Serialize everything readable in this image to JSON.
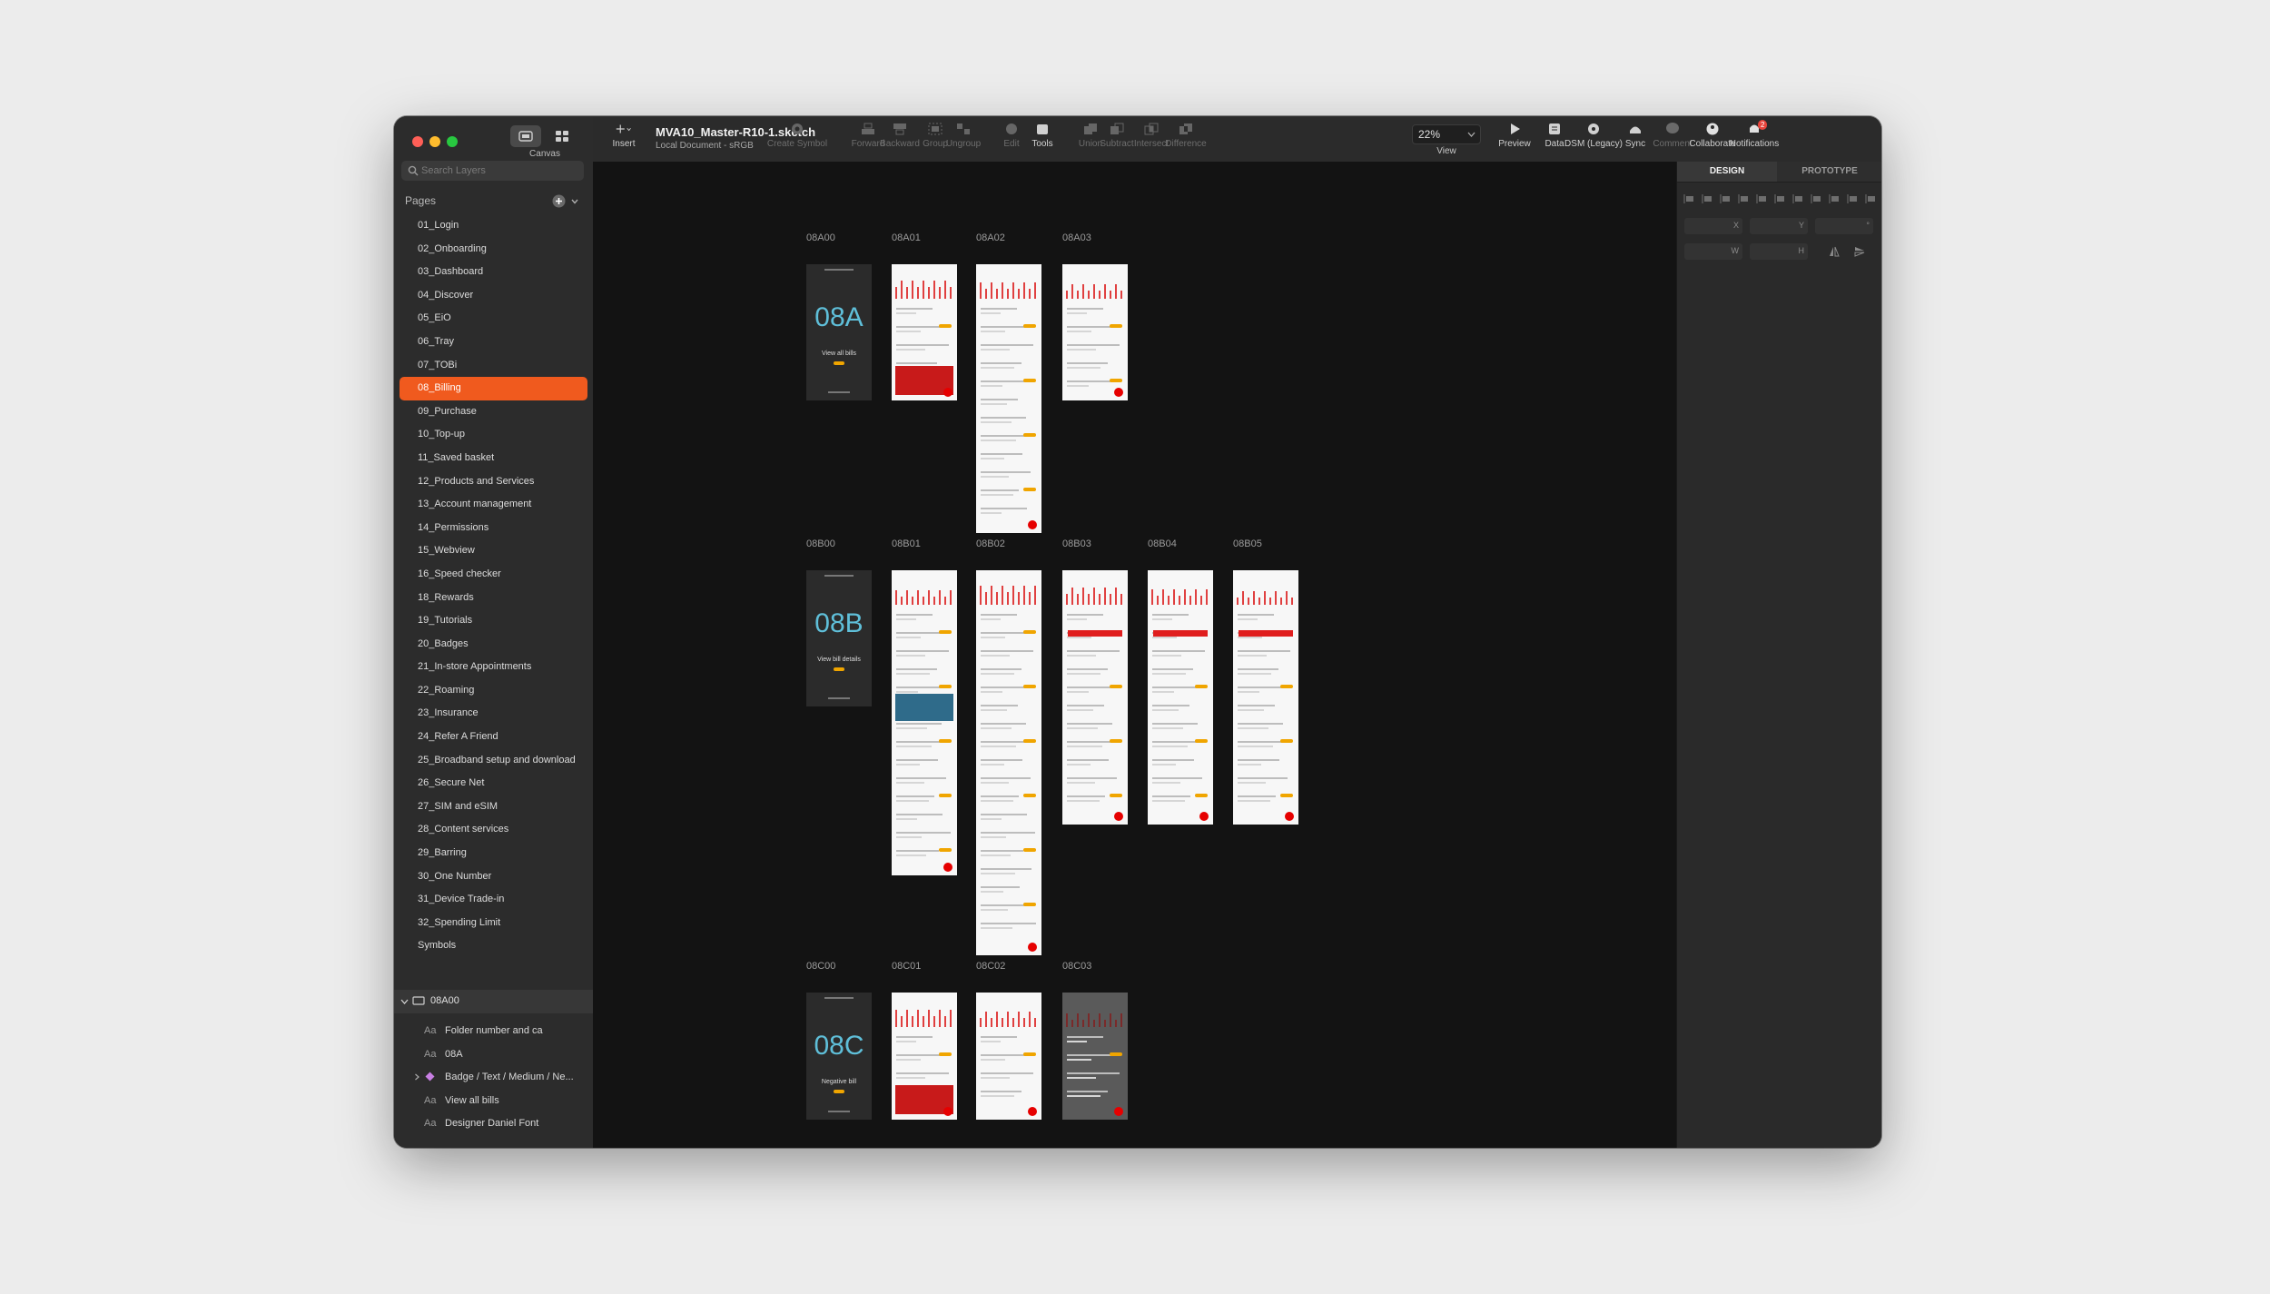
{
  "document": {
    "title": "MVA10_Master-R10-1.sketch",
    "subtitle": "Local Document - sRGB"
  },
  "sidebar": {
    "toggle_label": "Canvas",
    "search_placeholder": "Search Layers",
    "pages_heading": "Pages",
    "pages": [
      "01_Login",
      "02_Onboarding",
      "03_Dashboard",
      "04_Discover",
      "05_EiO",
      "06_Tray",
      "07_TOBi",
      "08_Billing",
      "09_Purchase",
      "10_Top-up",
      "11_Saved basket",
      "12_Products and Services",
      "13_Account management",
      "14_Permissions",
      "15_Webview",
      "16_Speed checker",
      "18_Rewards",
      "19_Tutorials",
      "20_Badges",
      "21_In-store Appointments",
      "22_Roaming",
      "23_Insurance",
      "24_Refer A Friend",
      "25_Broadband setup and download",
      "26_Secure Net",
      "27_SIM and eSIM",
      "28_Content services",
      "29_Barring",
      "30_One Number",
      "31_Device Trade-in",
      "32_Spending Limit",
      "Symbols"
    ],
    "selected_page": "08_Billing",
    "layers_artboard": "08A00",
    "layers": [
      {
        "label": "Folder number and ca",
        "icon": "text-icon"
      },
      {
        "label": "08A",
        "icon": "text-icon"
      },
      {
        "label": "Badge / Text / Medium / Ne...",
        "icon": "symbol-icon"
      },
      {
        "label": "View all bills",
        "icon": "text-icon"
      },
      {
        "label": "Designer Daniel Font",
        "icon": "text-icon"
      }
    ]
  },
  "toolbar": {
    "insert": "Insert",
    "buttons": [
      {
        "label": "Create Symbol",
        "icon": "symbol-icon"
      },
      {
        "label": "Forward",
        "icon": "forward-icon"
      },
      {
        "label": "Backward",
        "icon": "backward-icon"
      },
      {
        "label": "Group",
        "icon": "group-icon"
      },
      {
        "label": "Ungroup",
        "icon": "ungroup-icon"
      },
      {
        "label": "Edit",
        "icon": "edit-icon"
      },
      {
        "label": "Tools",
        "icon": "tools-icon"
      },
      {
        "label": "Union",
        "icon": "union-icon"
      },
      {
        "label": "Subtract",
        "icon": "subtract-icon"
      },
      {
        "label": "Intersect",
        "icon": "intersect-icon"
      },
      {
        "label": "Difference",
        "icon": "difference-icon"
      }
    ],
    "zoom": "22%",
    "view": "View",
    "right_buttons": [
      {
        "label": "Preview",
        "icon": "play-icon"
      },
      {
        "label": "Data",
        "icon": "data-icon"
      },
      {
        "label": "DSM (Legacy)",
        "icon": "dsm-icon"
      },
      {
        "label": "Sync",
        "icon": "sync-icon"
      },
      {
        "label": "Comment",
        "icon": "comment-icon"
      },
      {
        "label": "Collaborate",
        "icon": "collaborate-icon"
      },
      {
        "label": "Notifications",
        "icon": "bell-icon"
      }
    ],
    "notification_count": "2"
  },
  "inspector": {
    "tabs": [
      "DESIGN",
      "PROTOTYPE"
    ],
    "fields": [
      "X",
      "Y",
      "W",
      "H"
    ],
    "rotation_unit": "°"
  },
  "canvas": {
    "rows": [
      {
        "code": "08A",
        "caption": "View all bills",
        "artboards": [
          "08A00",
          "08A01",
          "08A02",
          "08A03"
        ]
      },
      {
        "code": "08B",
        "caption": "View bill details",
        "artboards": [
          "08B00",
          "08B01",
          "08B02",
          "08B03",
          "08B04",
          "08B05"
        ]
      },
      {
        "code": "08C",
        "caption": "Negative bill",
        "artboards": [
          "08C00",
          "08C01",
          "08C02",
          "08C03"
        ]
      }
    ]
  },
  "colors": {
    "accent": "#f05a1e",
    "brand_red": "#e60000",
    "cyan_code": "#5fbfd9",
    "badge": "#f0a500"
  }
}
